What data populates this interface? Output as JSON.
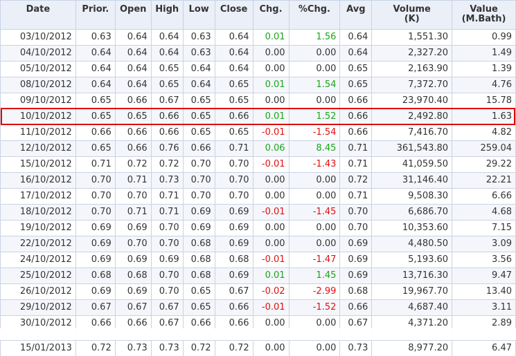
{
  "columns": [
    "Date",
    "Prior.",
    "Open",
    "High",
    "Low",
    "Close",
    "Chg.",
    "%Chg.",
    "Avg",
    "Volume\n(K)",
    "Value\n(M.Bath)"
  ],
  "rows": [
    {
      "date": "03/10/2012",
      "prior": "0.63",
      "open": "0.64",
      "high": "0.64",
      "low": "0.63",
      "close": "0.64",
      "chg": "0.01",
      "pchg": "1.56",
      "avg": "0.64",
      "volume": "1,551.30",
      "value": "0.99",
      "trend": "pos"
    },
    {
      "date": "04/10/2012",
      "prior": "0.64",
      "open": "0.64",
      "high": "0.64",
      "low": "0.63",
      "close": "0.64",
      "chg": "0.00",
      "pchg": "0.00",
      "avg": "0.64",
      "volume": "2,327.20",
      "value": "1.49",
      "trend": "zero"
    },
    {
      "date": "05/10/2012",
      "prior": "0.64",
      "open": "0.64",
      "high": "0.65",
      "low": "0.64",
      "close": "0.64",
      "chg": "0.00",
      "pchg": "0.00",
      "avg": "0.65",
      "volume": "2,163.90",
      "value": "1.39",
      "trend": "zero"
    },
    {
      "date": "08/10/2012",
      "prior": "0.64",
      "open": "0.64",
      "high": "0.65",
      "low": "0.64",
      "close": "0.65",
      "chg": "0.01",
      "pchg": "1.54",
      "avg": "0.65",
      "volume": "7,372.70",
      "value": "4.76",
      "trend": "pos"
    },
    {
      "date": "09/10/2012",
      "prior": "0.65",
      "open": "0.66",
      "high": "0.67",
      "low": "0.65",
      "close": "0.65",
      "chg": "0.00",
      "pchg": "0.00",
      "avg": "0.66",
      "volume": "23,970.40",
      "value": "15.78",
      "trend": "zero"
    },
    {
      "date": "10/10/2012",
      "prior": "0.65",
      "open": "0.65",
      "high": "0.66",
      "low": "0.65",
      "close": "0.66",
      "chg": "0.01",
      "pchg": "1.52",
      "avg": "0.66",
      "volume": "2,492.80",
      "value": "1.63",
      "trend": "pos",
      "highlighted": true
    },
    {
      "date": "11/10/2012",
      "prior": "0.66",
      "open": "0.66",
      "high": "0.66",
      "low": "0.65",
      "close": "0.65",
      "chg": "-0.01",
      "pchg": "-1.54",
      "avg": "0.66",
      "volume": "7,416.70",
      "value": "4.82",
      "trend": "neg"
    },
    {
      "date": "12/10/2012",
      "prior": "0.65",
      "open": "0.66",
      "high": "0.76",
      "low": "0.66",
      "close": "0.71",
      "chg": "0.06",
      "pchg": "8.45",
      "avg": "0.71",
      "volume": "361,543.80",
      "value": "259.04",
      "trend": "pos"
    },
    {
      "date": "15/10/2012",
      "prior": "0.71",
      "open": "0.72",
      "high": "0.72",
      "low": "0.70",
      "close": "0.70",
      "chg": "-0.01",
      "pchg": "-1.43",
      "avg": "0.71",
      "volume": "41,059.50",
      "value": "29.22",
      "trend": "neg"
    },
    {
      "date": "16/10/2012",
      "prior": "0.70",
      "open": "0.71",
      "high": "0.73",
      "low": "0.70",
      "close": "0.70",
      "chg": "0.00",
      "pchg": "0.00",
      "avg": "0.72",
      "volume": "31,146.40",
      "value": "22.21",
      "trend": "zero"
    },
    {
      "date": "17/10/2012",
      "prior": "0.70",
      "open": "0.70",
      "high": "0.71",
      "low": "0.70",
      "close": "0.70",
      "chg": "0.00",
      "pchg": "0.00",
      "avg": "0.71",
      "volume": "9,508.30",
      "value": "6.66",
      "trend": "zero"
    },
    {
      "date": "18/10/2012",
      "prior": "0.70",
      "open": "0.71",
      "high": "0.71",
      "low": "0.69",
      "close": "0.69",
      "chg": "-0.01",
      "pchg": "-1.45",
      "avg": "0.70",
      "volume": "6,686.70",
      "value": "4.68",
      "trend": "neg"
    },
    {
      "date": "19/10/2012",
      "prior": "0.69",
      "open": "0.69",
      "high": "0.70",
      "low": "0.69",
      "close": "0.69",
      "chg": "0.00",
      "pchg": "0.00",
      "avg": "0.70",
      "volume": "10,353.60",
      "value": "7.15",
      "trend": "zero"
    },
    {
      "date": "22/10/2012",
      "prior": "0.69",
      "open": "0.70",
      "high": "0.70",
      "low": "0.68",
      "close": "0.69",
      "chg": "0.00",
      "pchg": "0.00",
      "avg": "0.69",
      "volume": "4,480.50",
      "value": "3.09",
      "trend": "zero"
    },
    {
      "date": "24/10/2012",
      "prior": "0.69",
      "open": "0.69",
      "high": "0.69",
      "low": "0.68",
      "close": "0.68",
      "chg": "-0.01",
      "pchg": "-1.47",
      "avg": "0.69",
      "volume": "5,193.60",
      "value": "3.56",
      "trend": "neg"
    },
    {
      "date": "25/10/2012",
      "prior": "0.68",
      "open": "0.68",
      "high": "0.70",
      "low": "0.68",
      "close": "0.69",
      "chg": "0.01",
      "pchg": "1.45",
      "avg": "0.69",
      "volume": "13,716.30",
      "value": "9.47",
      "trend": "pos"
    },
    {
      "date": "26/10/2012",
      "prior": "0.69",
      "open": "0.69",
      "high": "0.70",
      "low": "0.65",
      "close": "0.67",
      "chg": "-0.02",
      "pchg": "-2.99",
      "avg": "0.68",
      "volume": "19,967.70",
      "value": "13.40",
      "trend": "neg"
    },
    {
      "date": "29/10/2012",
      "prior": "0.67",
      "open": "0.67",
      "high": "0.67",
      "low": "0.65",
      "close": "0.66",
      "chg": "-0.01",
      "pchg": "-1.52",
      "avg": "0.66",
      "volume": "4,687.40",
      "value": "3.11",
      "trend": "neg"
    },
    {
      "date": "30/10/2012",
      "prior": "0.66",
      "open": "0.66",
      "high": "0.67",
      "low": "0.66",
      "close": "0.66",
      "chg": "0.00",
      "pchg": "0.00",
      "avg": "0.67",
      "volume": "4,371.20",
      "value": "2.89",
      "trend": "zero"
    }
  ],
  "bottom_row": {
    "date": "15/01/2013",
    "prior": "0.72",
    "open": "0.73",
    "high": "0.73",
    "low": "0.72",
    "close": "0.72",
    "chg": "0.00",
    "pchg": "0.00",
    "avg": "0.73",
    "volume": "8,977.20",
    "value": "6.47",
    "trend": "zero"
  },
  "colors": {
    "positive": "#1aa51a",
    "negative": "#e01010",
    "highlight_border": "#e00000",
    "header_bg": "#eaeff8"
  }
}
